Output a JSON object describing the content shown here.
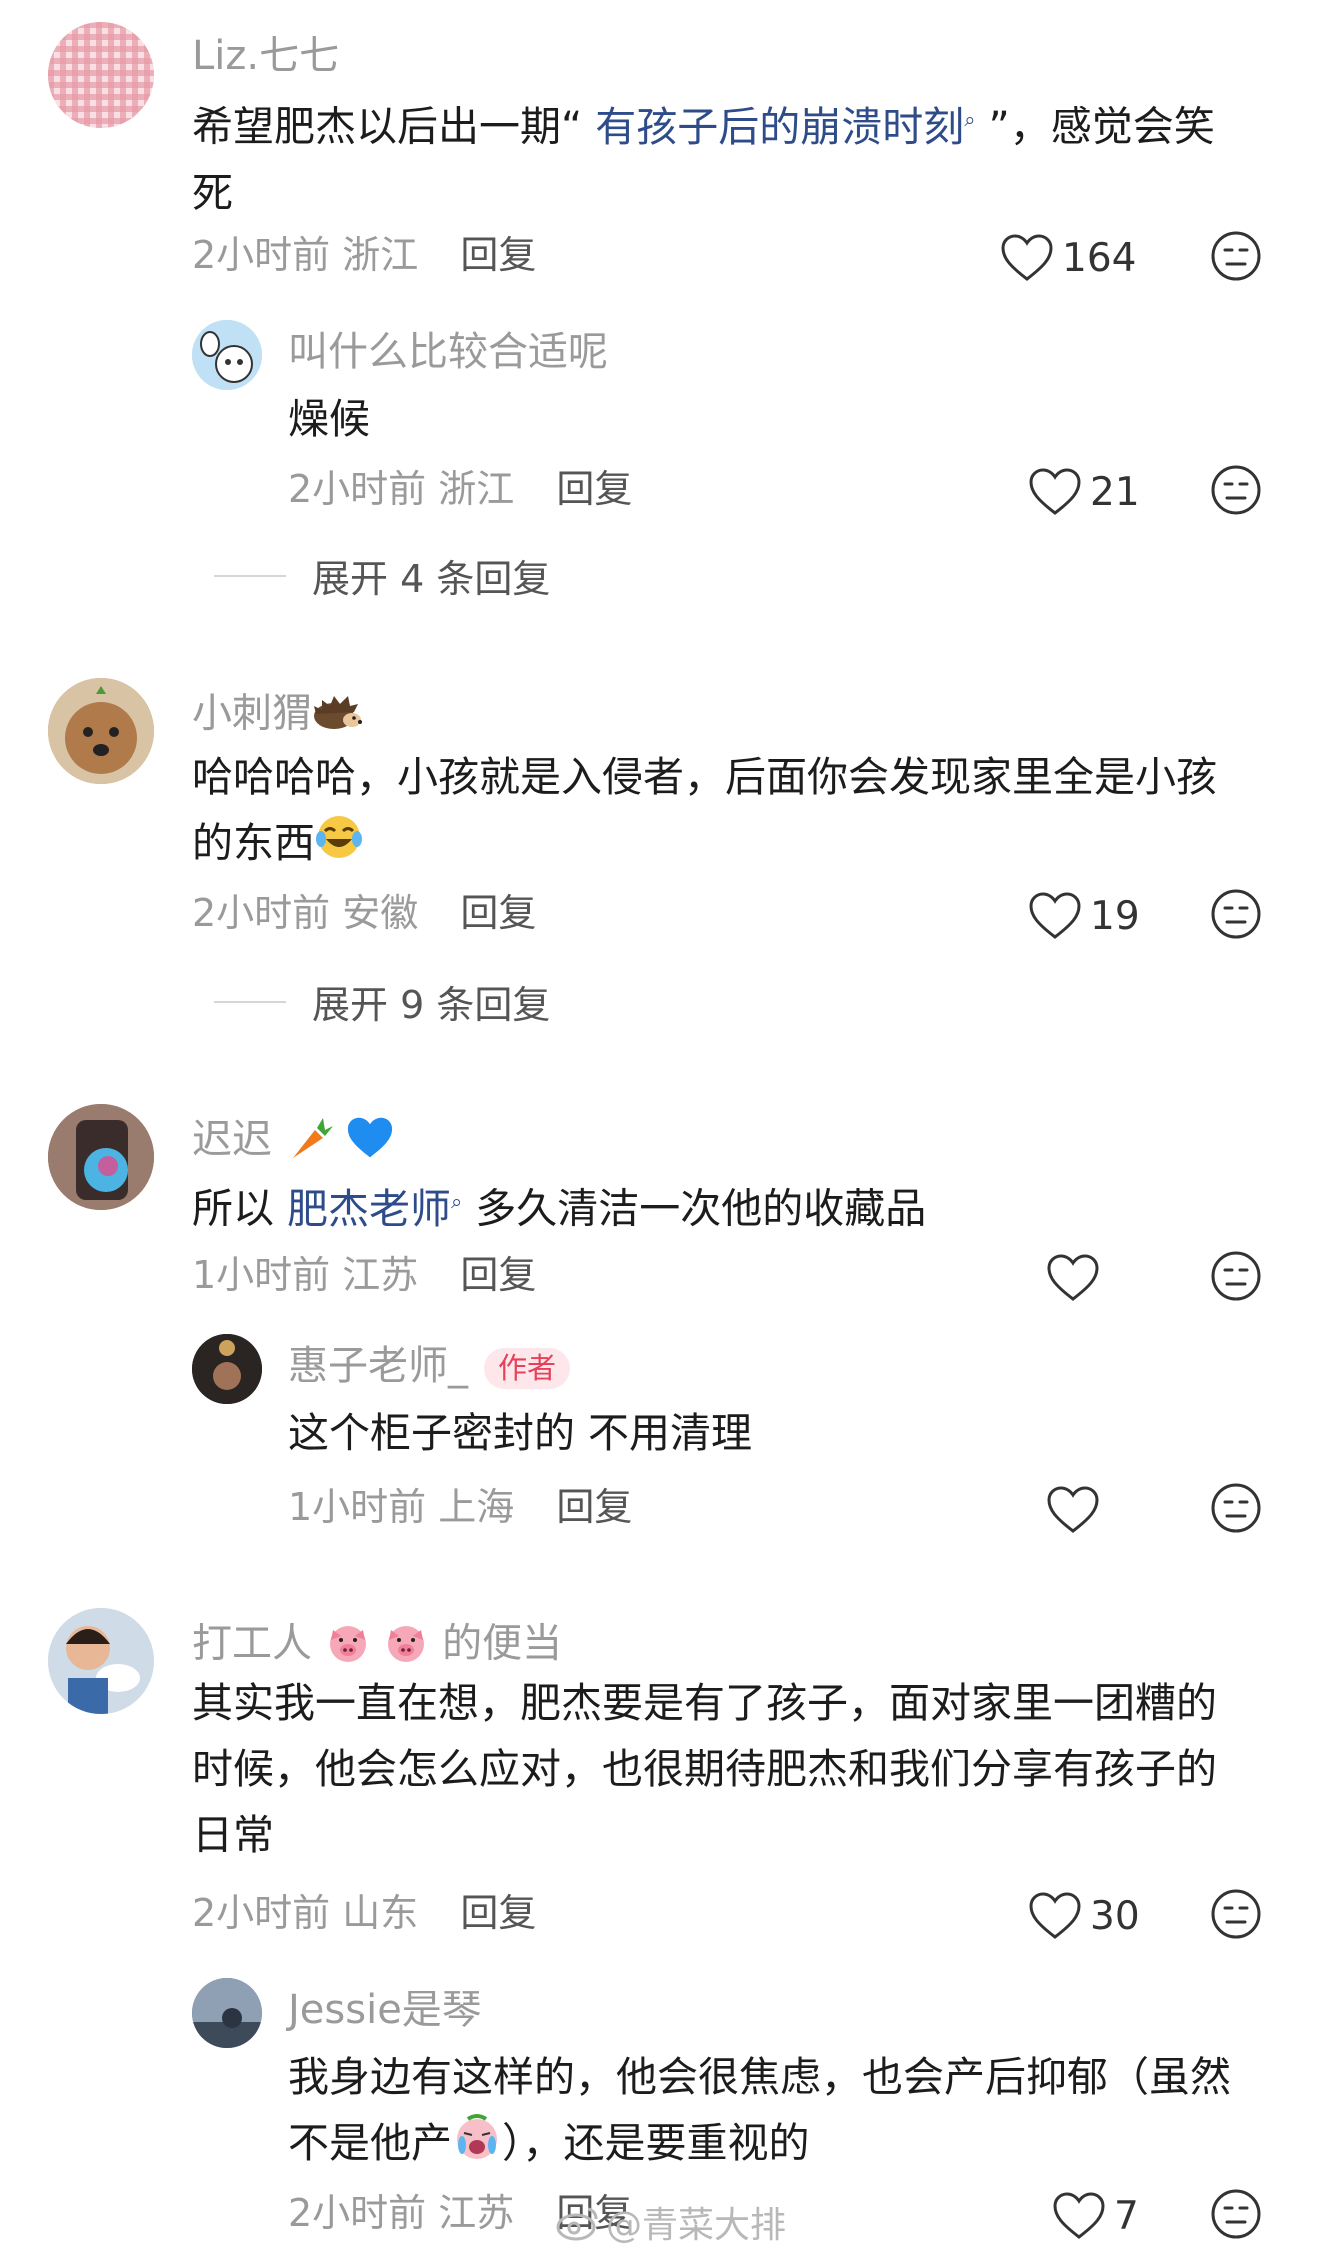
{
  "comments": [
    {
      "user": "Liz.七七",
      "text_parts": [
        "希望肥杰以后出一期“ ",
        "有孩子后的崩溃时刻",
        " ”，感觉会笑",
        "死"
      ],
      "time": "2小时前",
      "location": "浙江",
      "reply_label": "回复",
      "likes": "164",
      "replies": [
        {
          "user": "叫什么比较合适呢",
          "text": "燥候",
          "time": "2小时前",
          "location": "浙江",
          "reply_label": "回复",
          "likes": "21"
        }
      ],
      "expand": "展开 4 条回复"
    },
    {
      "user": "小刺猬",
      "text_parts": [
        "哈哈哈哈，小孩就是入侵者，后面你会发现家里全是小孩",
        "的东西"
      ],
      "time": "2小时前",
      "location": "安徽",
      "reply_label": "回复",
      "likes": "19",
      "expand": "展开 9 条回复"
    },
    {
      "user": "迟迟",
      "text_parts": [
        "所以 ",
        "肥杰老师",
        " 多久清洁一次他的收藏品"
      ],
      "time": "1小时前",
      "location": "江苏",
      "reply_label": "回复",
      "replies": [
        {
          "user": "惠子老师_",
          "badge": "作者",
          "text": "这个柜子密封的 不用清理",
          "time": "1小时前",
          "location": "上海",
          "reply_label": "回复"
        }
      ]
    },
    {
      "user_parts": [
        "打工人",
        "的便当"
      ],
      "text_parts": [
        "其实我一直在想，肥杰要是有了孩子，面对家里一团糟的",
        "时候，他会怎么应对，也很期待肥杰和我们分享有孩子的",
        "日常"
      ],
      "time": "2小时前",
      "location": "山东",
      "reply_label": "回复",
      "likes": "30",
      "replies": [
        {
          "user": "Jessie是琴",
          "text_parts": [
            "我身边有这样的，他会很焦虑，也会产后抑郁（虽然",
            "不是他产",
            "），还是要重视的"
          ],
          "time": "2小时前",
          "location": "江苏",
          "reply_label": "回复",
          "likes": "7"
        }
      ]
    }
  ],
  "watermark": "@青菜大排",
  "icons": {
    "like": "heart-outline-icon",
    "dislike": "dislike-face-icon",
    "search": "search-icon"
  },
  "colors": {
    "link": "#2e4b8a",
    "meta": "#9a9a9a",
    "badge_bg": "#fde7ea",
    "badge_text": "#e6405a"
  }
}
